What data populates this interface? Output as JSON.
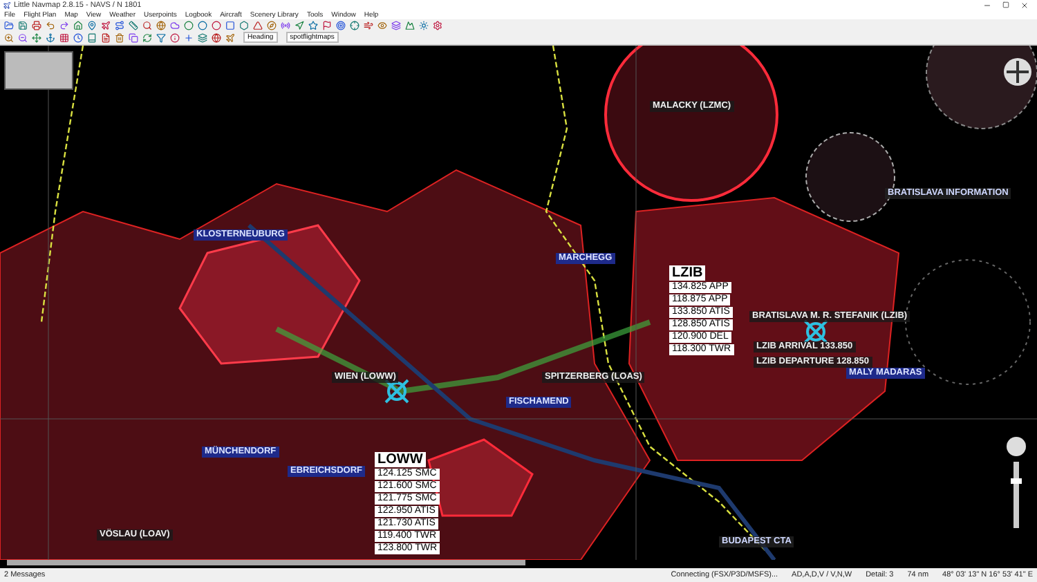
{
  "window": {
    "title": "Little Navmap 2.8.15 - NAVS / N 1801"
  },
  "menu": [
    "File",
    "Flight Plan",
    "Map",
    "View",
    "Weather",
    "Userpoints",
    "Logbook",
    "Aircraft",
    "Scenery Library",
    "Tools",
    "Window",
    "Help"
  ],
  "toolbar": {
    "dropdowns": [
      {
        "value": "Heading"
      },
      {
        "value": "spotflightmaps"
      }
    ]
  },
  "map": {
    "labels": [
      {
        "text": "MALACKY (LZMC)",
        "kind": "airport"
      },
      {
        "text": "BRATISLAVA INFORMATION",
        "kind": "airspace"
      },
      {
        "text": "KLOSTERNEUBURG",
        "kind": "navaid"
      },
      {
        "text": "MARCHEGG",
        "kind": "navaid"
      },
      {
        "text": "BRATISLAVA M. R. STEFANIK (LZIB)",
        "kind": "airport"
      },
      {
        "text": "LZIB ARRIVAL 133.850",
        "kind": "airport"
      },
      {
        "text": "LZIB DEPARTURE 128.850",
        "kind": "airport"
      },
      {
        "text": "MALY MADARAS",
        "kind": "navaid"
      },
      {
        "text": "WIEN (LOWW)",
        "kind": "airport"
      },
      {
        "text": "SPITZERBERG (LOAS)",
        "kind": "airport"
      },
      {
        "text": "FISCHAMEND",
        "kind": "navaid"
      },
      {
        "text": "MÜNCHENDORF",
        "kind": "navaid"
      },
      {
        "text": "EBREICHSDORF",
        "kind": "navaid"
      },
      {
        "text": "VÖSLAU (LOAV)",
        "kind": "airport"
      },
      {
        "text": "BUDAPEST CTA",
        "kind": "airspace"
      }
    ],
    "frequency_boxes": [
      {
        "ident": "LZIB",
        "lines": [
          "134.825 APP",
          "118.875 APP",
          "133.850 ATIS",
          "128.850 ATIS",
          "120.900 DEL",
          "118.300 TWR"
        ]
      },
      {
        "ident": "LOWW",
        "lines": [
          "124.125 SMC",
          "121.600 SMC",
          "121.775 SMC",
          "122.950 ATIS",
          "121.730 ATIS",
          "119.400 TWR",
          "123.800 TWR"
        ]
      }
    ]
  },
  "status_bar": {
    "messages": "2 Messages",
    "connection": "Connecting (FSX/P3D/MSFS)...",
    "filter": "AD,A,D,V / V,N,W",
    "detail": "Detail: 3",
    "distance": "74 nm",
    "position": "48° 03' 13\" N 16° 53' 41\" E"
  }
}
